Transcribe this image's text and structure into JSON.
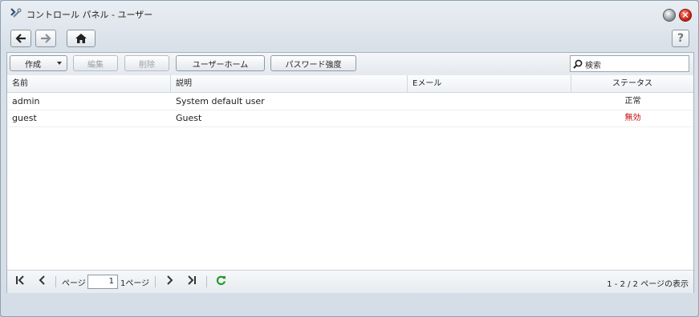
{
  "window": {
    "title": "コントロール パネル - ユーザー",
    "close_glyph": "✕"
  },
  "nav": {
    "back": "←",
    "forward": "→",
    "help": "?"
  },
  "toolbar": {
    "create_label": "作成",
    "edit_label": "編集",
    "delete_label": "削除",
    "user_home_label": "ユーザーホーム",
    "password_strength_label": "パスワード強度",
    "search_placeholder": "検索"
  },
  "table": {
    "columns": [
      "名前",
      "説明",
      "Eメール",
      "ステータス"
    ],
    "rows": [
      {
        "name": "admin",
        "description": "System default user",
        "email": "",
        "status": "正常",
        "status_color": "#222222"
      },
      {
        "name": "guest",
        "description": "Guest",
        "email": "",
        "status": "無効",
        "status_color": "#c00000"
      }
    ]
  },
  "pager": {
    "page_label": "ページ",
    "current_page": "1",
    "of_pages": "1ページ",
    "summary": "1 - 2 / 2 ページの表示"
  },
  "colors": {
    "refresh": "#2a9a2a",
    "accent": "#2f4f72"
  }
}
